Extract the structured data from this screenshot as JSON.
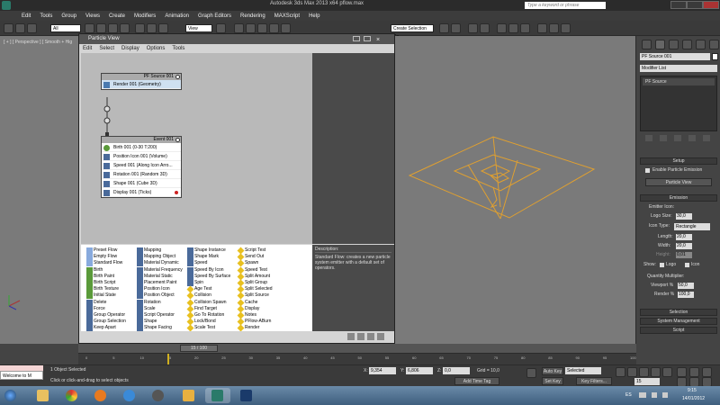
{
  "app": {
    "title": "Autodesk 3ds Max  2013 x64     pflow.max",
    "search_placeholder": "Type a keyword or phrase"
  },
  "menu": [
    "Edit",
    "Tools",
    "Group",
    "Views",
    "Create",
    "Modifiers",
    "Animation",
    "Graph Editors",
    "Rendering",
    "MAXScript",
    "Help"
  ],
  "toolbar": {
    "filter_value": "All",
    "coord_value": "View",
    "selection_set_placeholder": "Create Selection Se"
  },
  "viewport": {
    "label": "[ + ] [ Perspective ] [ Smooth + Hig"
  },
  "particle_view": {
    "title": "Particle View",
    "menu": [
      "Edit",
      "Select",
      "Display",
      "Options",
      "Tools"
    ],
    "source_node": {
      "title": "PF Source 001",
      "render_op": "Render 001 (Geometry)"
    },
    "event_node": {
      "title": "Event 001",
      "operators": [
        "Birth 001 (0-30 T:200)",
        "Position Icon 001 (Volume)",
        "Speed 001 (Along Icon Arro...",
        "Rotation 001 (Random 3D)",
        "Shape 001 (Cube 3D)",
        "Display 001 (Ticks)"
      ]
    },
    "depot": {
      "col1": [
        "Preset Flow",
        "Empty Flow",
        "Standard Flow",
        "Birth",
        "Birth Paint",
        "Birth Script",
        "Birth Texture",
        "Initial State",
        "Delete",
        "Force",
        "Group Operator",
        "Group Selection",
        "Keep Apart"
      ],
      "col2": [
        "Mapping",
        "Mapping Object",
        "Material Dynamic",
        "Material Frequency",
        "Material Static",
        "Placement Paint",
        "Position Icon",
        "Position Object",
        "Rotation",
        "Scale",
        "Script Operator",
        "Shape",
        "Shape Facing"
      ],
      "col3": [
        "Shape Instance",
        "Shape Mark",
        "Speed",
        "Speed By Icon",
        "Speed By Surface",
        "Spin",
        "Age Test",
        "Collision",
        "Collision Spawn",
        "Find Target",
        "Go To Rotation",
        "Lock/Bond",
        "Scale Test"
      ],
      "col4": [
        "Script Test",
        "Send Out",
        "Spawn",
        "Speed Test",
        "Split Amount",
        "Split Group",
        "Split Selected",
        "Split Source",
        "Cache",
        "Display",
        "Notes",
        "PFlow-ABurn",
        "Render"
      ]
    },
    "description": {
      "heading": "Description:",
      "text": "Standard Flow: creates a new particle system emitter with a default set of operators."
    }
  },
  "command_panel": {
    "object_name": "PF Source 001",
    "modifier_list": "Modifier List",
    "stack_item": "PF Source",
    "setup": {
      "title": "Setup",
      "enable_label": "Enable Particle Emission",
      "particle_view_btn": "Particle View"
    },
    "emission": {
      "title": "Emission",
      "emitter_icon": "Emitter Icon:",
      "logo_size_label": "Logo Size:",
      "logo_size": "30,0",
      "icon_type_label": "Icon Type:",
      "icon_type": "Rectangle",
      "length_label": "Length:",
      "length": "20,0",
      "width_label": "Width:",
      "width": "20,0",
      "height_label": "Height:",
      "height": "0,01",
      "show_label": "Show:",
      "show_logo": "Logo",
      "show_icon": "Icon",
      "quantity_label": "Quantity Multiplier:",
      "viewport_label": "Viewport %",
      "viewport": "50,0",
      "render_label": "Render %",
      "render": "100,0"
    },
    "rollouts": [
      "Selection",
      "System Management",
      "Script"
    ]
  },
  "timeline": {
    "slider": "15 / 100",
    "ticks": [
      "0",
      "5",
      "10",
      "15",
      "20",
      "25",
      "30",
      "35",
      "40",
      "45",
      "50",
      "55",
      "60",
      "65",
      "70",
      "75",
      "80",
      "85",
      "90",
      "95",
      "100"
    ]
  },
  "status": {
    "maxscript": "Welcome to M",
    "selected": "1 Object Selected",
    "prompt": "Click or click-and-drag to select objects",
    "x_label": "X:",
    "x": "9,354",
    "y_label": "Y:",
    "y": "6,806",
    "z_label": "Z:",
    "z": "0,0",
    "grid": "Grid = 10,0",
    "add_time_tag": "Add Time Tag",
    "auto_key": "Auto Key",
    "selected_dd": "Selected",
    "set_key": "Set Key",
    "key_filters": "Key Filters...",
    "frame": "15"
  },
  "taskbar": {
    "lang": "ES",
    "time": "9:15",
    "date": "14/01/2012"
  },
  "colors": {
    "viewport_bg": "#7a7a7a",
    "emitter_wire": "#e0a030",
    "depot_bg": "#ffffff",
    "graph_bg": "#b9b9b9"
  }
}
